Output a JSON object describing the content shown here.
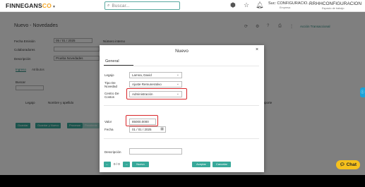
{
  "topbar": {
    "brand": "FINNEGANS",
    "brand_co": "CO",
    "search_placeholder": "Buscar...",
    "sucursal": "Suc: CONFIGURACIO...",
    "sucursal_sub": "Empresa",
    "user": "RRHHCONFIGURACION",
    "user_sub": "Espacio de trabajo"
  },
  "background": {
    "page_title": "Nuevo - Novedades",
    "accion_label": "Acción Transaccional",
    "fields": {
      "fecha_emision_label": "Fecha Emisión",
      "fecha_emision_value": "05 / 01 / 2025",
      "colaboradores_label": "Colaboradores",
      "descripcion_label": "Descripción",
      "descripcion_value": "Prueba Novedades",
      "numero_interno_label": "Número interno"
    },
    "tabs": [
      "Ingreso",
      "Atributos"
    ],
    "buscar_label": "Buscar",
    "columns": [
      "Legajo",
      "Nombre y apellido",
      "Importe"
    ],
    "buttons": [
      "Guardar",
      "Guardar y Nuevo",
      "Procesar",
      "Pendiente"
    ]
  },
  "modal": {
    "title": "Nuevo",
    "close": "×",
    "tab_general": "General",
    "legajo_label": "Legajo",
    "legajo_value": "Lamna, David",
    "tipo_label": "Tipo De Novedad",
    "tipo_value": "Ajuste Remunerativo",
    "centro_label": "Centro De Costos",
    "centro_value": "Administración",
    "valor_label": "Valor",
    "valor_value": "85000.0000",
    "fecha_label": "Fecha",
    "fecha_value": "01 / 01 / 2025",
    "descripcion_label": "Descripción",
    "descripcion_value": "",
    "counter": "0 / 0",
    "btn_nuevo": "Nuevo",
    "btn_aceptar": "Aceptar",
    "btn_cancelar": "Cancelar"
  },
  "chat": {
    "label": "Chat"
  },
  "colors": {
    "accent": "#38a99a",
    "highlight": "#d9262a",
    "chat": "#f6c11c",
    "brand_co": "#f5a623"
  },
  "icons": {
    "search": "search-icon",
    "cube": "cube-icon",
    "star": "star-icon",
    "bell": "bell-icon",
    "close": "close-icon",
    "chevron": "chevron-down-icon",
    "calendar": "calendar-icon",
    "prev": "arrow-left-icon",
    "next": "arrow-right-icon",
    "chat": "chat-bubble-icon"
  }
}
